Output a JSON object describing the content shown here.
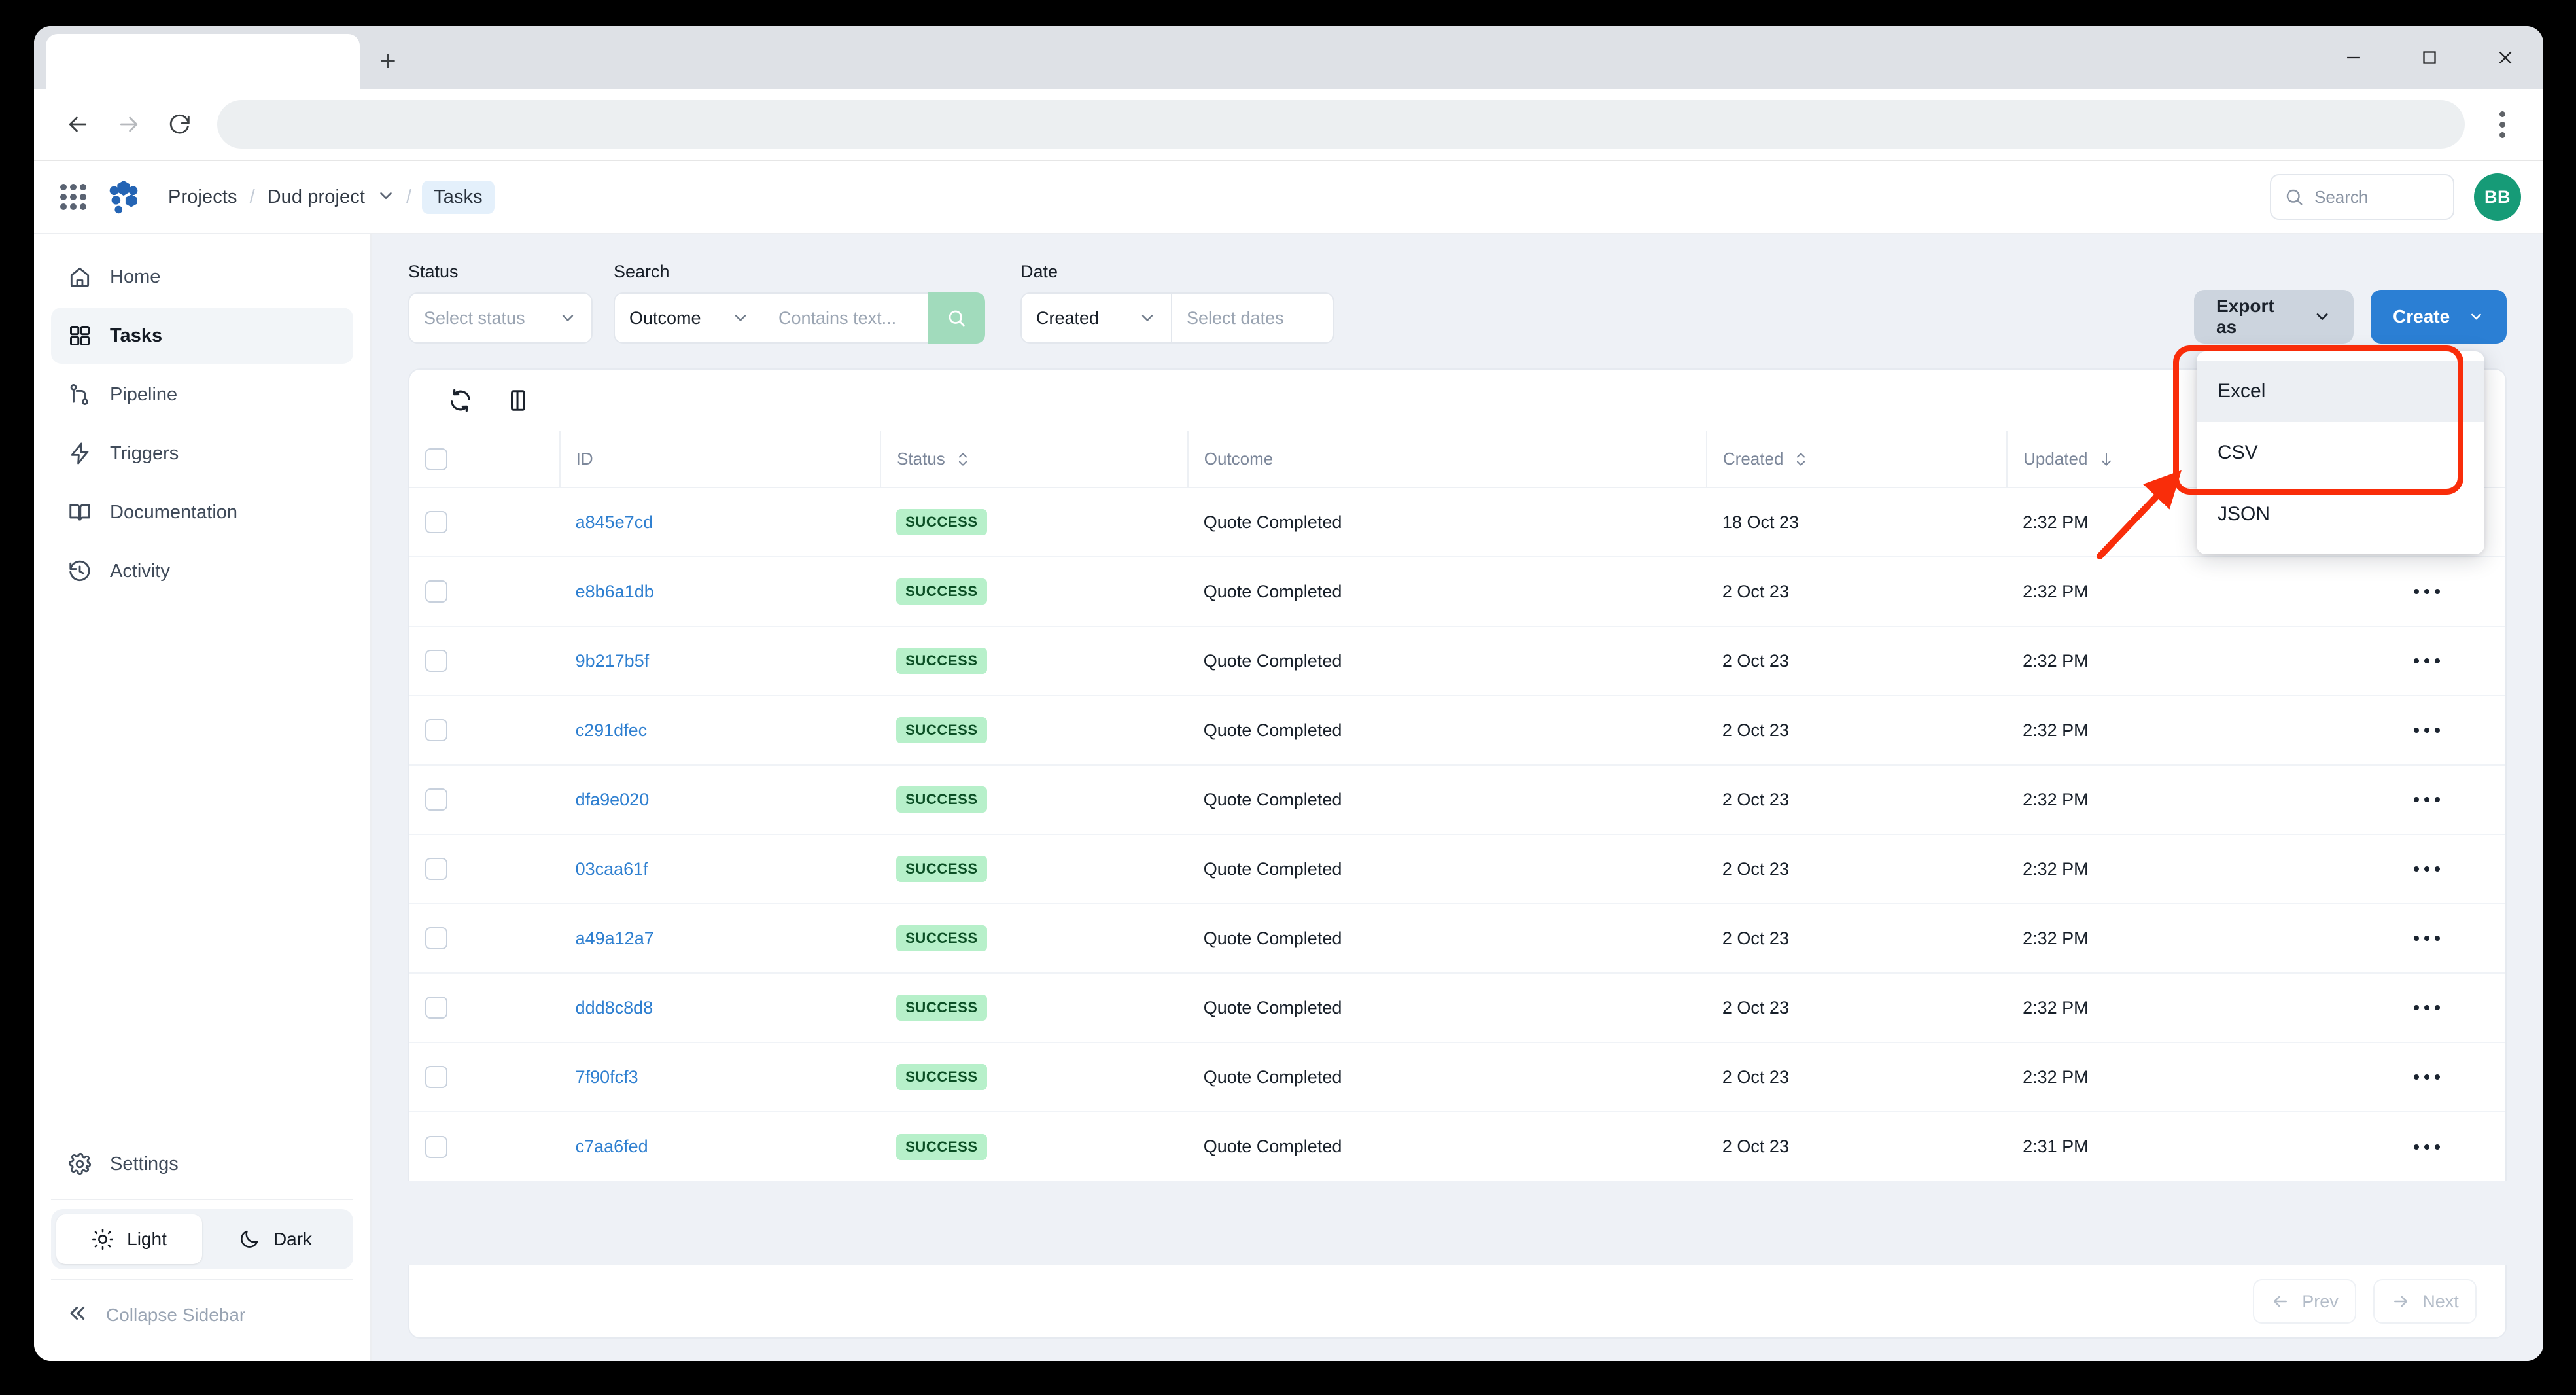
{
  "browser": {
    "tab_title": "",
    "url": "",
    "back_icon": "back-arrow-icon",
    "forward_icon": "forward-arrow-icon",
    "reload_icon": "reload-icon",
    "menu_icon": "kebab-menu-icon",
    "new_tab_label": "+",
    "minimize_label": "minimize",
    "maximize_label": "maximize",
    "close_label": "close"
  },
  "app_header": {
    "apps_icon": "apps-grid-icon",
    "logo_icon": "hexagon-cluster-logo",
    "breadcrumbs": [
      {
        "label": "Projects",
        "has_chevron": false,
        "active": false
      },
      {
        "label": "Dud project",
        "has_chevron": true,
        "active": false
      },
      {
        "label": "Tasks",
        "has_chevron": false,
        "active": true
      }
    ],
    "separator": "/",
    "search_placeholder": "Search",
    "avatar_initials": "BB",
    "avatar_color": "#169b77"
  },
  "sidebar": {
    "items": [
      {
        "label": "Home",
        "icon": "home-icon",
        "active": false
      },
      {
        "label": "Tasks",
        "icon": "grid-squares-icon",
        "active": true
      },
      {
        "label": "Pipeline",
        "icon": "git-branch-icon",
        "active": false
      },
      {
        "label": "Triggers",
        "icon": "lightning-bolt-icon",
        "active": false
      },
      {
        "label": "Documentation",
        "icon": "open-book-icon",
        "active": false
      },
      {
        "label": "Activity",
        "icon": "clock-history-icon",
        "active": false
      }
    ],
    "settings": {
      "label": "Settings",
      "icon": "gear-icon"
    },
    "theme": {
      "light_label": "Light",
      "light_icon": "sun-icon",
      "dark_label": "Dark",
      "dark_icon": "moon-icon",
      "selected": "Light"
    },
    "collapse": {
      "label": "Collapse Sidebar",
      "icon": "double-chevron-left-icon"
    }
  },
  "filters": {
    "status": {
      "label": "Status",
      "placeholder": "Select status",
      "value": ""
    },
    "search": {
      "label": "Search",
      "field_value": "Outcome",
      "text_placeholder": "Contains text...",
      "text_value": "",
      "submit_icon": "search-icon",
      "submit_color": "#a1dbbc"
    },
    "date": {
      "label": "Date",
      "field_value": "Created",
      "range_placeholder": "Select dates",
      "range_value": ""
    }
  },
  "actions": {
    "export_label": "Export as",
    "export_chevron": "chevron-down-icon",
    "create_label": "Create",
    "create_chevron": "chevron-down-icon",
    "create_color": "#2b7fd4",
    "export_color": "#ccd4de"
  },
  "export_menu": {
    "open": true,
    "items": [
      {
        "label": "Excel",
        "hovered": true
      },
      {
        "label": "CSV",
        "hovered": false
      },
      {
        "label": "JSON",
        "hovered": false
      }
    ],
    "highlight_color": "#f92d0a"
  },
  "table_tools": {
    "refresh_icon": "refresh-icon",
    "columns_icon": "panel-layout-icon"
  },
  "table": {
    "columns": [
      {
        "key": "checkbox",
        "label": "",
        "sort": "none"
      },
      {
        "key": "id",
        "label": "ID",
        "sort": "none"
      },
      {
        "key": "status",
        "label": "Status",
        "sort": "sortable"
      },
      {
        "key": "outcome",
        "label": "Outcome",
        "sort": "none"
      },
      {
        "key": "created",
        "label": "Created",
        "sort": "sortable"
      },
      {
        "key": "updated",
        "label": "Updated",
        "sort": "desc"
      },
      {
        "key": "actions",
        "label": "",
        "sort": "none"
      }
    ],
    "rows": [
      {
        "id": "a845e7cd",
        "status": "SUCCESS",
        "outcome": "Quote Completed",
        "created": "18 Oct 23",
        "updated": "2:32 PM",
        "selected": false
      },
      {
        "id": "e8b6a1db",
        "status": "SUCCESS",
        "outcome": "Quote Completed",
        "created": "2 Oct 23",
        "updated": "2:32 PM",
        "selected": false
      },
      {
        "id": "9b217b5f",
        "status": "SUCCESS",
        "outcome": "Quote Completed",
        "created": "2 Oct 23",
        "updated": "2:32 PM",
        "selected": false
      },
      {
        "id": "c291dfec",
        "status": "SUCCESS",
        "outcome": "Quote Completed",
        "created": "2 Oct 23",
        "updated": "2:32 PM",
        "selected": false
      },
      {
        "id": "dfa9e020",
        "status": "SUCCESS",
        "outcome": "Quote Completed",
        "created": "2 Oct 23",
        "updated": "2:32 PM",
        "selected": false
      },
      {
        "id": "03caa61f",
        "status": "SUCCESS",
        "outcome": "Quote Completed",
        "created": "2 Oct 23",
        "updated": "2:32 PM",
        "selected": false
      },
      {
        "id": "a49a12a7",
        "status": "SUCCESS",
        "outcome": "Quote Completed",
        "created": "2 Oct 23",
        "updated": "2:32 PM",
        "selected": false
      },
      {
        "id": "ddd8c8d8",
        "status": "SUCCESS",
        "outcome": "Quote Completed",
        "created": "2 Oct 23",
        "updated": "2:32 PM",
        "selected": false
      },
      {
        "id": "7f90fcf3",
        "status": "SUCCESS",
        "outcome": "Quote Completed",
        "created": "2 Oct 23",
        "updated": "2:32 PM",
        "selected": false
      },
      {
        "id": "c7aa6fed",
        "status": "SUCCESS",
        "outcome": "Quote Completed",
        "created": "2 Oct 23",
        "updated": "2:31 PM",
        "selected": false
      }
    ],
    "row_action_icon": "ellipsis-icon",
    "status_badge_bg": "#b7f0ca",
    "status_badge_fg": "#0b4f25",
    "id_link_color": "#2e7fd0"
  },
  "pagination": {
    "prev_label": "Prev",
    "prev_icon": "arrow-left-icon",
    "next_label": "Next",
    "next_icon": "arrow-right-icon",
    "prev_enabled": false,
    "next_enabled": false
  }
}
